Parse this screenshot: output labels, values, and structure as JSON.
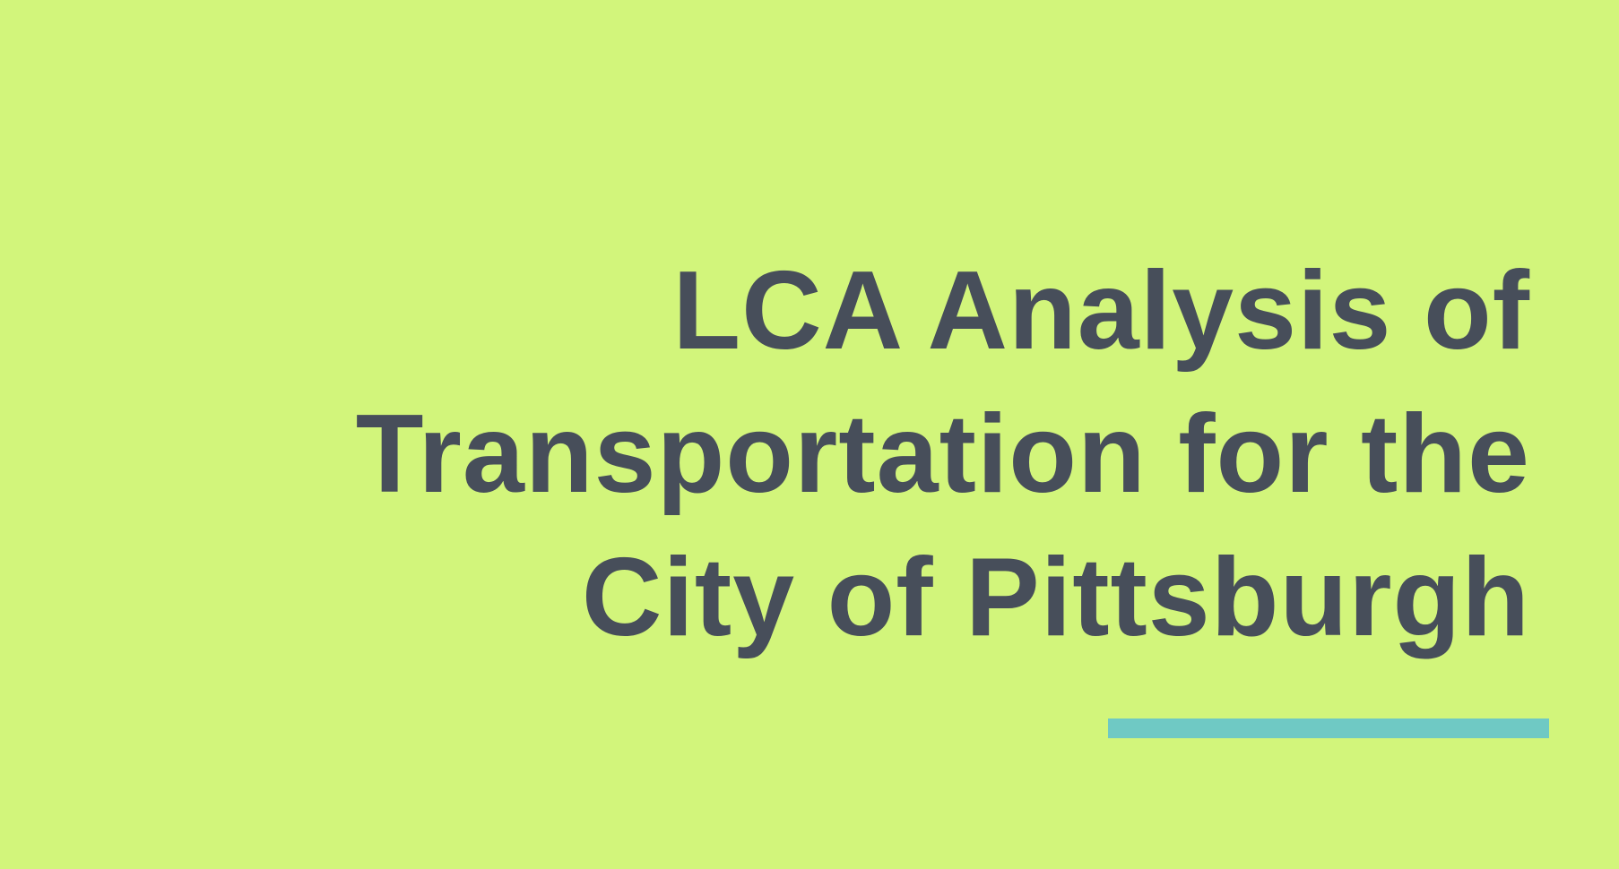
{
  "slide": {
    "title_lines": [
      "LCA Analysis of",
      "Transportation for the",
      "City of Pittsburgh"
    ],
    "colors": {
      "background": "#d2f57b",
      "title_text": "#474e5a",
      "accent_bar": "#6fc9c4"
    }
  }
}
